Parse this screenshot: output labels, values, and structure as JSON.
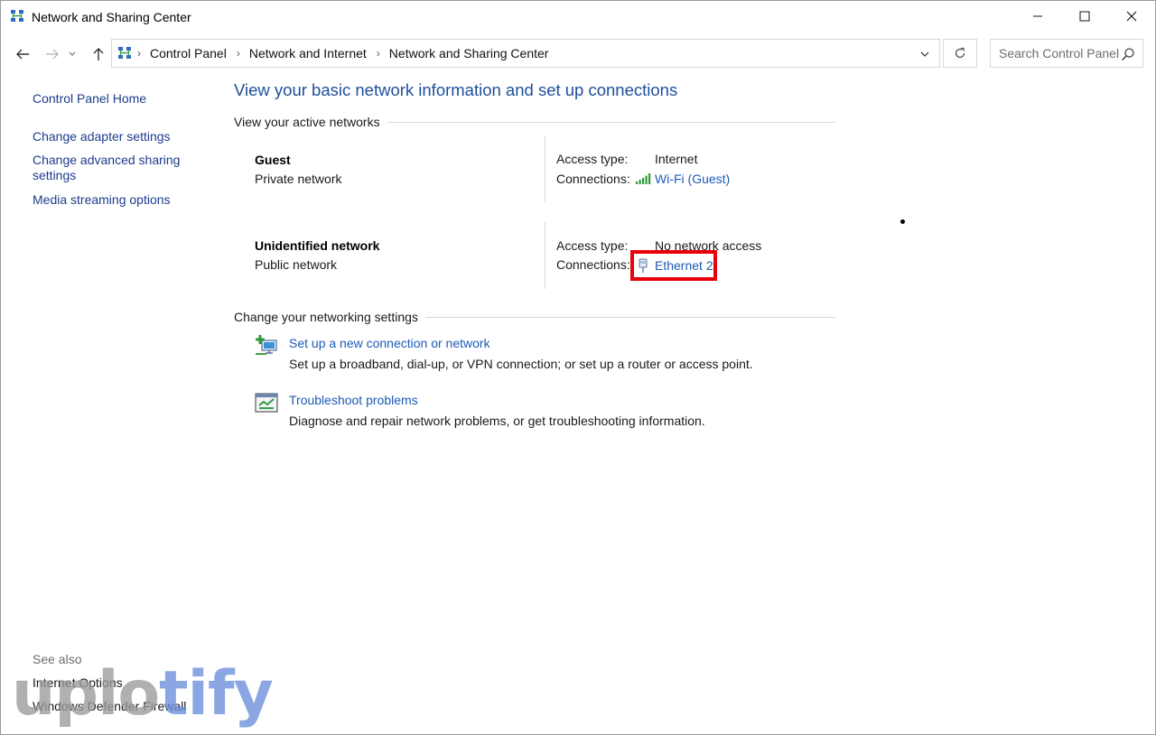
{
  "window": {
    "title": "Network and Sharing Center"
  },
  "nav": {
    "breadcrumbs": [
      "Control Panel",
      "Network and Internet",
      "Network and Sharing Center"
    ],
    "search_placeholder": "Search Control Panel"
  },
  "sidebar": {
    "links": [
      "Control Panel Home",
      "Change adapter settings",
      "Change advanced sharing settings",
      "Media streaming options"
    ],
    "see_also_label": "See also",
    "see_also_links": [
      "Internet Options",
      "Windows Defender Firewall"
    ]
  },
  "main": {
    "title": "View your basic network information and set up connections",
    "active_networks_heading": "View your active networks",
    "networks": [
      {
        "name": "Guest",
        "type": "Private network",
        "access_label": "Access type:",
        "access_value": "Internet",
        "connections_label": "Connections:",
        "connection": "Wi-Fi (Guest)",
        "connection_icon": "wifi-signal-icon"
      },
      {
        "name": "Unidentified network",
        "type": "Public network",
        "access_label": "Access type:",
        "access_value": "No network access",
        "connections_label": "Connections:",
        "connection": "Ethernet 2",
        "connection_icon": "ethernet-plug-icon"
      }
    ],
    "change_settings_heading": "Change your networking settings",
    "tasks": [
      {
        "link": "Set up a new connection or network",
        "description": "Set up a broadband, dial-up, or VPN connection; or set up a router or access point.",
        "icon": "new-connection-icon"
      },
      {
        "link": "Troubleshoot problems",
        "description": "Diagnose and repair network problems, or get troubleshooting information.",
        "icon": "troubleshoot-icon"
      }
    ]
  },
  "watermark": {
    "part1": "uplo",
    "part2": "tify"
  },
  "colors": {
    "link": "#1e5ab8",
    "title": "#1e4e9a",
    "sidebar_link": "#1c3c8c",
    "highlight": "#e8000b"
  }
}
